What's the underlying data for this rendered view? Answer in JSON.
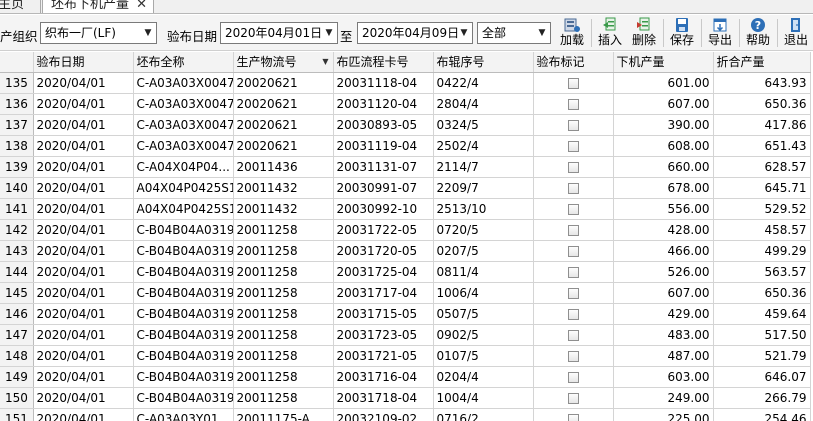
{
  "tabs": [
    {
      "label": "主页面"
    },
    {
      "label": "坯布下机产量",
      "close": "✕"
    }
  ],
  "toolbar": {
    "org_label": "产组织",
    "org_value": "织布一厂(LF)",
    "date_label": "验布日期",
    "date_from": "2020年04月01日",
    "to_label": "至",
    "date_to": "2020年04月09日",
    "filter_value": "全部",
    "buttons": {
      "load": "加载",
      "insert": "插入",
      "delete": "删除",
      "save": "保存",
      "export": "导出",
      "help": "帮助",
      "exit": "退出"
    }
  },
  "table": {
    "columns": [
      "验布日期",
      "坯布全称",
      "生产物流号",
      "布匹流程卡号",
      "布辊序号",
      "验布标记",
      "下机产量",
      "折合产量"
    ],
    "rows": [
      {
        "n": "135",
        "date": "2020/04/01",
        "name": "C-A03A03X0047",
        "lot": "20020621",
        "card": "20031118-04",
        "roll": "0422/4",
        "qty": "601.00",
        "conv": "643.93"
      },
      {
        "n": "136",
        "date": "2020/04/01",
        "name": "C-A03A03X0047",
        "lot": "20020621",
        "card": "20031120-04",
        "roll": "2804/4",
        "qty": "607.00",
        "conv": "650.36"
      },
      {
        "n": "137",
        "date": "2020/04/01",
        "name": "C-A03A03X0047",
        "lot": "20020621",
        "card": "20030893-05",
        "roll": "0324/5",
        "qty": "390.00",
        "conv": "417.86"
      },
      {
        "n": "138",
        "date": "2020/04/01",
        "name": "C-A03A03X0047",
        "lot": "20020621",
        "card": "20031119-04",
        "roll": "2502/4",
        "qty": "608.00",
        "conv": "651.43"
      },
      {
        "n": "139",
        "date": "2020/04/01",
        "name": "C-A04X04P04...",
        "lot": "20011436",
        "card": "20031131-07",
        "roll": "2114/7",
        "qty": "660.00",
        "conv": "628.57"
      },
      {
        "n": "140",
        "date": "2020/04/01",
        "name": "A04X04P0425S1",
        "lot": "20011432",
        "card": "20030991-07",
        "roll": "2209/7",
        "qty": "678.00",
        "conv": "645.71"
      },
      {
        "n": "141",
        "date": "2020/04/01",
        "name": "A04X04P0425S1",
        "lot": "20011432",
        "card": "20030992-10",
        "roll": "2513/10",
        "qty": "556.00",
        "conv": "529.52"
      },
      {
        "n": "142",
        "date": "2020/04/01",
        "name": "C-B04B04A0319",
        "lot": "20011258",
        "card": "20031722-05",
        "roll": "0720/5",
        "qty": "428.00",
        "conv": "458.57"
      },
      {
        "n": "143",
        "date": "2020/04/01",
        "name": "C-B04B04A0319",
        "lot": "20011258",
        "card": "20031720-05",
        "roll": "0207/5",
        "qty": "466.00",
        "conv": "499.29"
      },
      {
        "n": "144",
        "date": "2020/04/01",
        "name": "C-B04B04A0319",
        "lot": "20011258",
        "card": "20031725-04",
        "roll": "0811/4",
        "qty": "526.00",
        "conv": "563.57"
      },
      {
        "n": "145",
        "date": "2020/04/01",
        "name": "C-B04B04A0319",
        "lot": "20011258",
        "card": "20031717-04",
        "roll": "1006/4",
        "qty": "607.00",
        "conv": "650.36"
      },
      {
        "n": "146",
        "date": "2020/04/01",
        "name": "C-B04B04A0319",
        "lot": "20011258",
        "card": "20031715-05",
        "roll": "0507/5",
        "qty": "429.00",
        "conv": "459.64"
      },
      {
        "n": "147",
        "date": "2020/04/01",
        "name": "C-B04B04A0319",
        "lot": "20011258",
        "card": "20031723-05",
        "roll": "0902/5",
        "qty": "483.00",
        "conv": "517.50"
      },
      {
        "n": "148",
        "date": "2020/04/01",
        "name": "C-B04B04A0319",
        "lot": "20011258",
        "card": "20031721-05",
        "roll": "0107/5",
        "qty": "487.00",
        "conv": "521.79"
      },
      {
        "n": "149",
        "date": "2020/04/01",
        "name": "C-B04B04A0319",
        "lot": "20011258",
        "card": "20031716-04",
        "roll": "0204/4",
        "qty": "603.00",
        "conv": "646.07"
      },
      {
        "n": "150",
        "date": "2020/04/01",
        "name": "C-B04B04A0319",
        "lot": "20011258",
        "card": "20031718-04",
        "roll": "1004/4",
        "qty": "249.00",
        "conv": "266.79"
      },
      {
        "n": "151",
        "date": "2020/04/01",
        "name": "C-A03A03Y01...",
        "lot": "20011175-A",
        "card": "20032109-02",
        "roll": "0716/2",
        "qty": "225.00",
        "conv": "254.46"
      }
    ]
  },
  "colors": {
    "toolbar_bg": "#f4f4f4",
    "header_bg": "#f3f3f3",
    "grid_line": "#d4d4d4",
    "icon_blue": "#2d6fb7",
    "icon_green": "#3a9a4a"
  }
}
